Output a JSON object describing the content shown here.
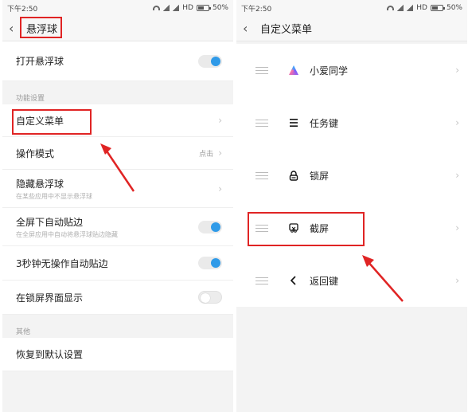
{
  "left": {
    "status": {
      "time": "下午2:50",
      "network": "HD",
      "battery": "50%"
    },
    "header": {
      "title": "悬浮球"
    },
    "toggle_row": {
      "label": "打开悬浮球",
      "state": "on"
    },
    "section_function": "功能设置",
    "items": [
      {
        "label": "自定义菜单",
        "sub": "",
        "value": ""
      },
      {
        "label": "操作模式",
        "sub": "",
        "value": "点击"
      },
      {
        "label": "隐藏悬浮球",
        "sub": "在某些应用中不显示悬浮球",
        "value": ""
      }
    ],
    "toggles": [
      {
        "label": "全屏下自动贴边",
        "sub": "在全屏应用中自动将悬浮球贴边隐藏",
        "state": "on"
      },
      {
        "label": "3秒钟无操作自动贴边",
        "sub": "",
        "state": "on"
      },
      {
        "label": "在锁屏界面显示",
        "sub": "",
        "state": "off"
      }
    ],
    "section_other": "其他",
    "reset_label": "恢复到默认设置"
  },
  "right": {
    "status": {
      "time": "下午2:50",
      "network": "HD",
      "battery": "50%"
    },
    "header": {
      "title": "自定义菜单"
    },
    "menu_items": [
      {
        "label": "小爱同学",
        "icon": "xiaoai-icon"
      },
      {
        "label": "任务键",
        "icon": "menu-lines-icon"
      },
      {
        "label": "锁屏",
        "icon": "lock-icon"
      },
      {
        "label": "截屏",
        "icon": "screenshot-icon"
      },
      {
        "label": "返回键",
        "icon": "back-arrow-icon"
      }
    ]
  },
  "colors": {
    "toggle_on": "#2f9ae8",
    "annotation": "#e02424"
  }
}
